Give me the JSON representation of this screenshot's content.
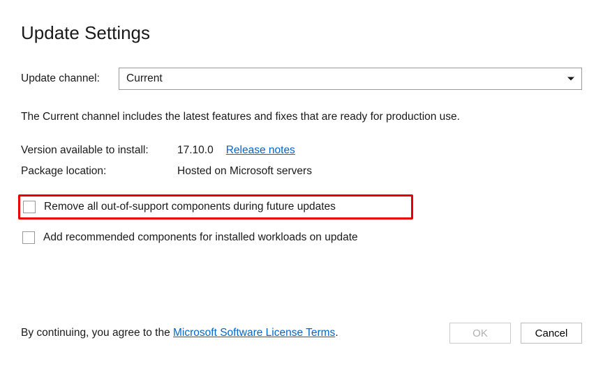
{
  "title": "Update Settings",
  "channel": {
    "label": "Update channel:",
    "value": "Current"
  },
  "description": "The Current channel includes the latest features and fixes that are ready for production use.",
  "version": {
    "label": "Version available to install:",
    "value": "17.10.0",
    "release_notes": "Release notes"
  },
  "package": {
    "label": "Package location:",
    "value": "Hosted on Microsoft servers"
  },
  "checkboxes": {
    "remove_oos": "Remove all out-of-support components during future updates",
    "add_recommended": "Add recommended components for installed workloads on update"
  },
  "footer": {
    "prefix": "By continuing, you agree to the ",
    "link": "Microsoft Software License Terms",
    "suffix": "."
  },
  "buttons": {
    "ok": "OK",
    "cancel": "Cancel"
  }
}
